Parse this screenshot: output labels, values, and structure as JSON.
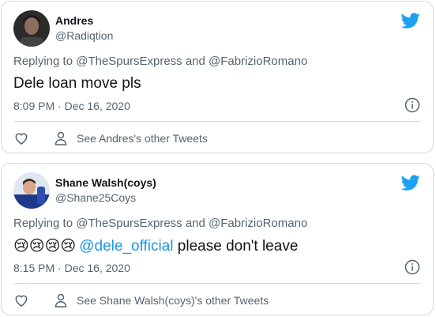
{
  "tweets": [
    {
      "name": "Andres",
      "handle": "@Radiqtion",
      "replying_to": "Replying to @TheSpursExpress and @FabrizioRomano",
      "text": "Dele loan move pls",
      "timestamp": "8:09 PM · Dec 16, 2020",
      "other_tweets": "See Andres's other Tweets"
    },
    {
      "name": "Shane Walsh(coys)",
      "handle": "@Shane25Coys",
      "replying_to": "Replying to @TheSpursExpress and @FabrizioRomano",
      "emoji_prefix": "😢😢😢😢",
      "mention": "@dele_official",
      "text_after": " please don't leave",
      "timestamp": "8:15 PM · Dec 16, 2020",
      "other_tweets": "See Shane Walsh(coys)'s other Tweets"
    }
  ],
  "icons": {
    "bird": "twitter-bird-icon",
    "info": "info-icon",
    "heart": "heart-icon",
    "profile": "person-icon"
  },
  "colors": {
    "brand": "#1da1f2",
    "mention": "#1b95e0",
    "muted": "#536471",
    "text": "#0f1419",
    "border": "#d3dbe2"
  }
}
